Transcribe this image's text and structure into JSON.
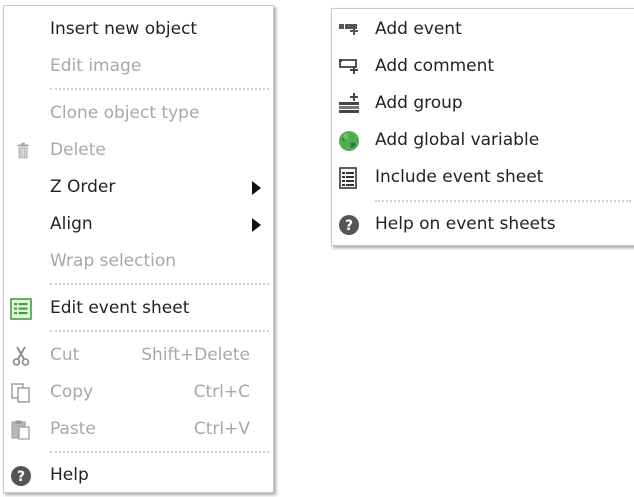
{
  "left_menu": {
    "items": [
      {
        "label": "Insert new object",
        "shortcut": "",
        "enabled": true
      },
      {
        "label": "Edit image",
        "shortcut": "",
        "enabled": false
      },
      {
        "label": "Clone object type",
        "shortcut": "",
        "enabled": false,
        "icon": ""
      },
      {
        "label": "Delete",
        "shortcut": "",
        "enabled": false,
        "icon": "trash-icon"
      },
      {
        "label": "Z Order",
        "shortcut": "",
        "enabled": true,
        "submenu": true
      },
      {
        "label": "Align",
        "shortcut": "",
        "enabled": true,
        "submenu": true
      },
      {
        "label": "Wrap selection",
        "shortcut": "",
        "enabled": false
      },
      {
        "label": "Edit event sheet",
        "shortcut": "",
        "enabled": true,
        "icon": "event-sheet-icon"
      },
      {
        "label": "Cut",
        "shortcut": "Shift+Delete",
        "enabled": false,
        "icon": "scissors-icon"
      },
      {
        "label": "Copy",
        "shortcut": "Ctrl+C",
        "enabled": false,
        "icon": "copy-icon"
      },
      {
        "label": "Paste",
        "shortcut": "Ctrl+V",
        "enabled": false,
        "icon": "paste-icon"
      },
      {
        "label": "Help",
        "shortcut": "",
        "enabled": true,
        "icon": "help-icon"
      }
    ]
  },
  "right_menu": {
    "items": [
      {
        "label": "Add event",
        "icon": "add-event-icon",
        "enabled": true
      },
      {
        "label": "Add comment",
        "icon": "add-comment-icon",
        "enabled": true
      },
      {
        "label": "Add group",
        "icon": "add-group-icon",
        "enabled": true
      },
      {
        "label": "Add global variable",
        "icon": "globe-icon",
        "enabled": true
      },
      {
        "label": "Include event sheet",
        "icon": "include-sheet-icon",
        "enabled": true
      },
      {
        "label": "Help on event sheets",
        "icon": "help-icon",
        "enabled": true
      }
    ]
  },
  "colors": {
    "text": "#222222",
    "disabled_text": "#a8a8a8",
    "separator": "#cfcfcf",
    "help_icon": "#555555",
    "globe_green": "#4caf50",
    "sheet_green": "#3aa635"
  }
}
